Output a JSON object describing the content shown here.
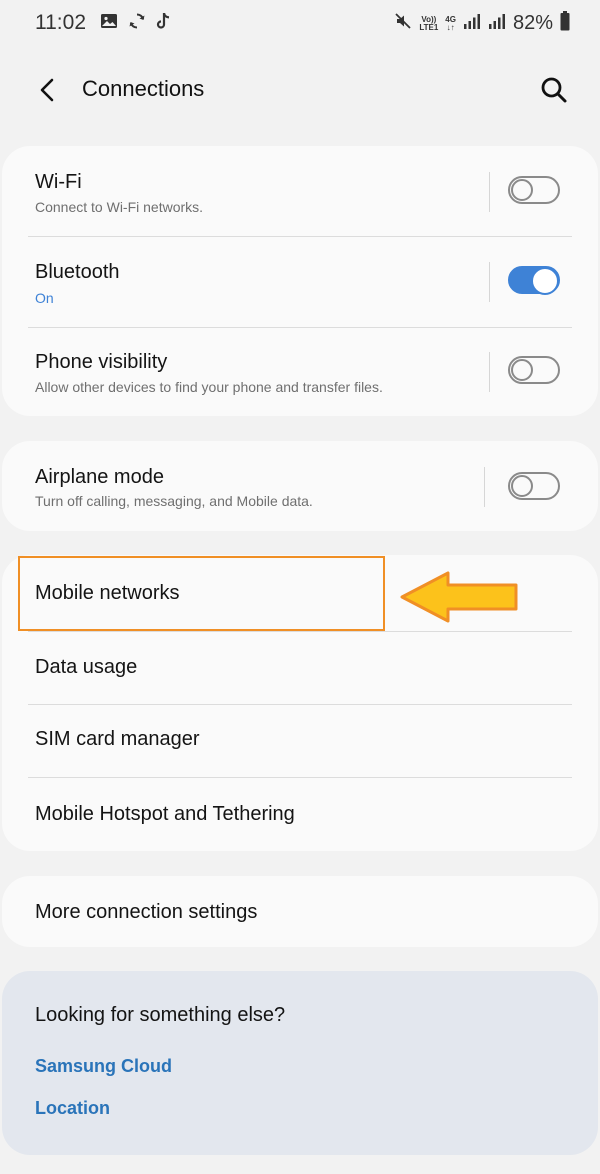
{
  "status_bar": {
    "time": "11:02",
    "volte_label": "Vo))",
    "lte_label": "LTE1",
    "network_type": "4G",
    "battery_percent": "82%",
    "left_icons": [
      "gallery-icon",
      "sync-icon",
      "tiktok-icon"
    ],
    "right_icons": [
      "mute-icon",
      "signal-icon",
      "signal-icon",
      "battery-icon"
    ]
  },
  "header": {
    "title": "Connections",
    "back_icon": "back-arrow-icon",
    "search_icon": "search-icon"
  },
  "group1": [
    {
      "title": "Wi-Fi",
      "subtitle": "Connect to Wi-Fi networks.",
      "toggle_on": false
    },
    {
      "title": "Bluetooth",
      "subtitle": "On",
      "toggle_on": true
    },
    {
      "title": "Phone visibility",
      "subtitle": "Allow other devices to find your phone and transfer files.",
      "toggle_on": false
    }
  ],
  "group2": [
    {
      "title": "Airplane mode",
      "subtitle": "Turn off calling, messaging, and Mobile data.",
      "toggle_on": false
    }
  ],
  "group3": [
    {
      "title": "Mobile networks"
    },
    {
      "title": "Data usage"
    },
    {
      "title": "SIM card manager"
    },
    {
      "title": "Mobile Hotspot and Tethering"
    }
  ],
  "group4": [
    {
      "title": "More connection settings"
    }
  ],
  "help": {
    "title": "Looking for something else?",
    "links": [
      "Samsung Cloud",
      "Location"
    ]
  },
  "annotation": {
    "highlight_color": "#f08f25",
    "arrow_color": "#fcc21b",
    "highlighted_item": "Mobile networks"
  },
  "colors": {
    "accent": "#3e82d6",
    "link": "#2a74b9",
    "background": "#f2f2f2",
    "card": "#fafafa",
    "help_card": "#e3e7ee"
  }
}
